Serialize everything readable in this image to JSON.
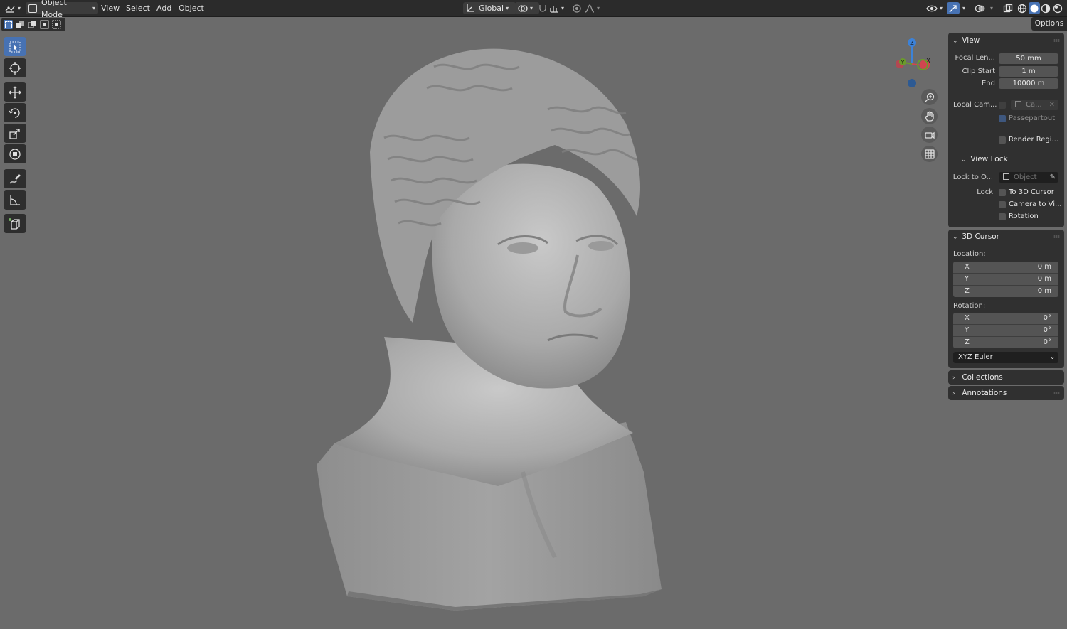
{
  "header": {
    "mode_label": "Object Mode",
    "menus": [
      "View",
      "Select",
      "Add",
      "Object"
    ],
    "transform_orientation": "Global"
  },
  "options_tab": "Options",
  "view_panel": {
    "title": "View",
    "focal_length_label": "Focal Len...",
    "focal_length_value": "50 mm",
    "clip_start_label": "Clip Start",
    "clip_start_value": "1 m",
    "clip_end_label": "End",
    "clip_end_value": "10000 m",
    "local_camera_label": "Local Cam...",
    "local_camera_value": "Ca...",
    "passepartout_label": "Passepartout",
    "passepartout_checked": true,
    "render_region_label": "Render Regi...",
    "view_lock": {
      "title": "View Lock",
      "lock_to_object_label": "Lock to O...",
      "lock_to_object_placeholder": "Object",
      "lock_label": "Lock",
      "to_3d_cursor_label": "To 3D Cursor",
      "camera_to_view_label": "Camera to Vi...",
      "rotation_label": "Rotation"
    }
  },
  "cursor_panel": {
    "title": "3D Cursor",
    "location_label": "Location:",
    "location": [
      {
        "axis": "X",
        "value": "0 m"
      },
      {
        "axis": "Y",
        "value": "0 m"
      },
      {
        "axis": "Z",
        "value": "0 m"
      }
    ],
    "rotation_label": "Rotation:",
    "rotation": [
      {
        "axis": "X",
        "value": "0°"
      },
      {
        "axis": "Y",
        "value": "0°"
      },
      {
        "axis": "Z",
        "value": "0°"
      }
    ],
    "rotation_mode": "XYZ Euler"
  },
  "collections_panel": {
    "title": "Collections"
  },
  "annotations_panel": {
    "title": "Annotations"
  },
  "gizmo": {
    "z_label": "Z",
    "y_label": "Y",
    "x_label": "X"
  },
  "colors": {
    "accent": "#4772b3",
    "axis_x": "#d0464f",
    "axis_y": "#6b9b2b",
    "axis_z": "#3c82d8"
  }
}
